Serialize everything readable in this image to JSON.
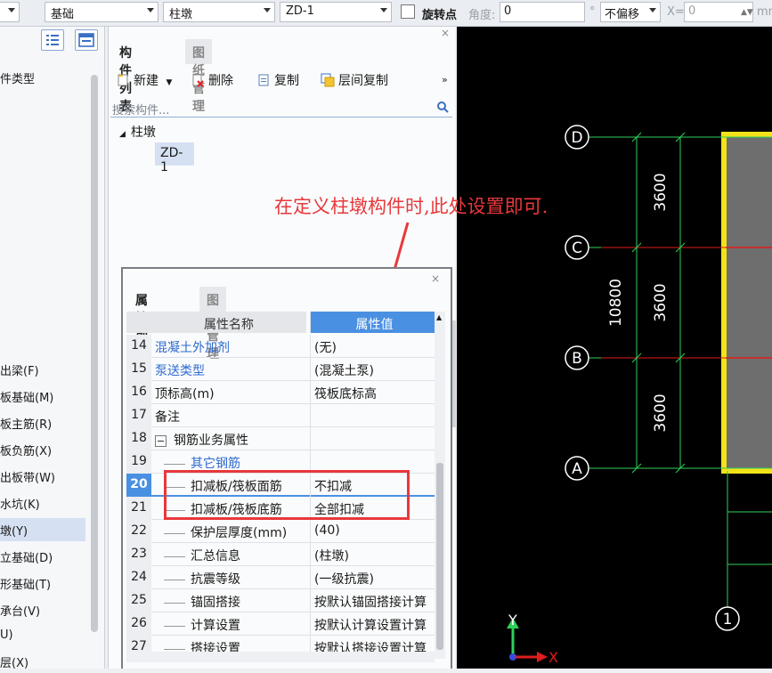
{
  "toolbar": {
    "combo1": "基础",
    "combo2": "柱墩",
    "combo3": "ZD-1",
    "rotate_label": "旋转点",
    "angle_label": "角度:",
    "angle_value": "0",
    "degree_unit": "°",
    "offset_value": "不偏移",
    "x_label": "X=",
    "x_value": "0",
    "unit": "mm"
  },
  "left_panel": {
    "header": "件类型",
    "items": [
      "出梁(F)",
      "板基础(M)",
      "板主筋(R)",
      "板负筋(X)",
      "出板带(W)",
      "水坑(K)",
      "墩(Y)",
      "立基础(D)",
      "形基础(T)",
      "承台(V)",
      "U)",
      "层(X)"
    ],
    "selected_index": 6
  },
  "component_list": {
    "tab_active": "构件列表",
    "tab_inactive": "图纸管理",
    "buttons": {
      "new": "新建",
      "delete": "删除",
      "copy": "复制",
      "floor_copy": "层间复制"
    },
    "search_placeholder": "搜索构件...",
    "tree_root": "柱墩",
    "tree_child": "ZD-1"
  },
  "annotation": "在定义柱墩构件时,此处设置即可.",
  "property_panel": {
    "tab_active": "属性列表",
    "tab_inactive": "图层管理",
    "col_name": "属性名称",
    "col_value": "属性值",
    "rows": [
      {
        "num": "14",
        "name": "混凝土外加剂",
        "value": "(无)",
        "link": true,
        "indent": 0
      },
      {
        "num": "15",
        "name": "泵送类型",
        "value": "(混凝土泵)",
        "link": true,
        "indent": 0
      },
      {
        "num": "16",
        "name": "顶标高(m)",
        "value": "筏板底标高",
        "link": false,
        "indent": 0
      },
      {
        "num": "17",
        "name": "备注",
        "value": "",
        "link": false,
        "indent": 0
      },
      {
        "num": "18",
        "name": "钢筋业务属性",
        "value": "",
        "link": false,
        "indent": 0,
        "group": true
      },
      {
        "num": "19",
        "name": "其它钢筋",
        "value": "",
        "link": true,
        "indent": 1
      },
      {
        "num": "20",
        "name": "扣减板/筏板面筋",
        "value": "不扣减",
        "link": false,
        "indent": 1,
        "selected": true
      },
      {
        "num": "21",
        "name": "扣减板/筏板底筋",
        "value": "全部扣减",
        "link": false,
        "indent": 1
      },
      {
        "num": "22",
        "name": "保护层厚度(mm)",
        "value": "(40)",
        "link": false,
        "indent": 1
      },
      {
        "num": "23",
        "name": "汇总信息",
        "value": "(柱墩)",
        "link": false,
        "indent": 1
      },
      {
        "num": "24",
        "name": "抗震等级",
        "value": "(一级抗震)",
        "link": false,
        "indent": 1
      },
      {
        "num": "25",
        "name": "锚固搭接",
        "value": "按默认锚固搭接计算",
        "link": false,
        "indent": 1
      },
      {
        "num": "26",
        "name": "计算设置",
        "value": "按默认计算设置计算",
        "link": false,
        "indent": 1
      },
      {
        "num": "27",
        "name": "搭接设置",
        "value": "按默认搭接设置计算",
        "link": false,
        "indent": 1
      }
    ]
  },
  "cad": {
    "axis_labels": [
      "D",
      "C",
      "B",
      "A",
      "1"
    ],
    "dims": [
      "3600",
      "3600",
      "3600",
      "10800"
    ],
    "y_axis": "Y",
    "x_axis": "X",
    "colors": {
      "axis_green": "#2fd05a",
      "red_line": "#e01c1c",
      "yellow": "#f2e21a",
      "fill_gray": "#6e6e6e"
    }
  }
}
